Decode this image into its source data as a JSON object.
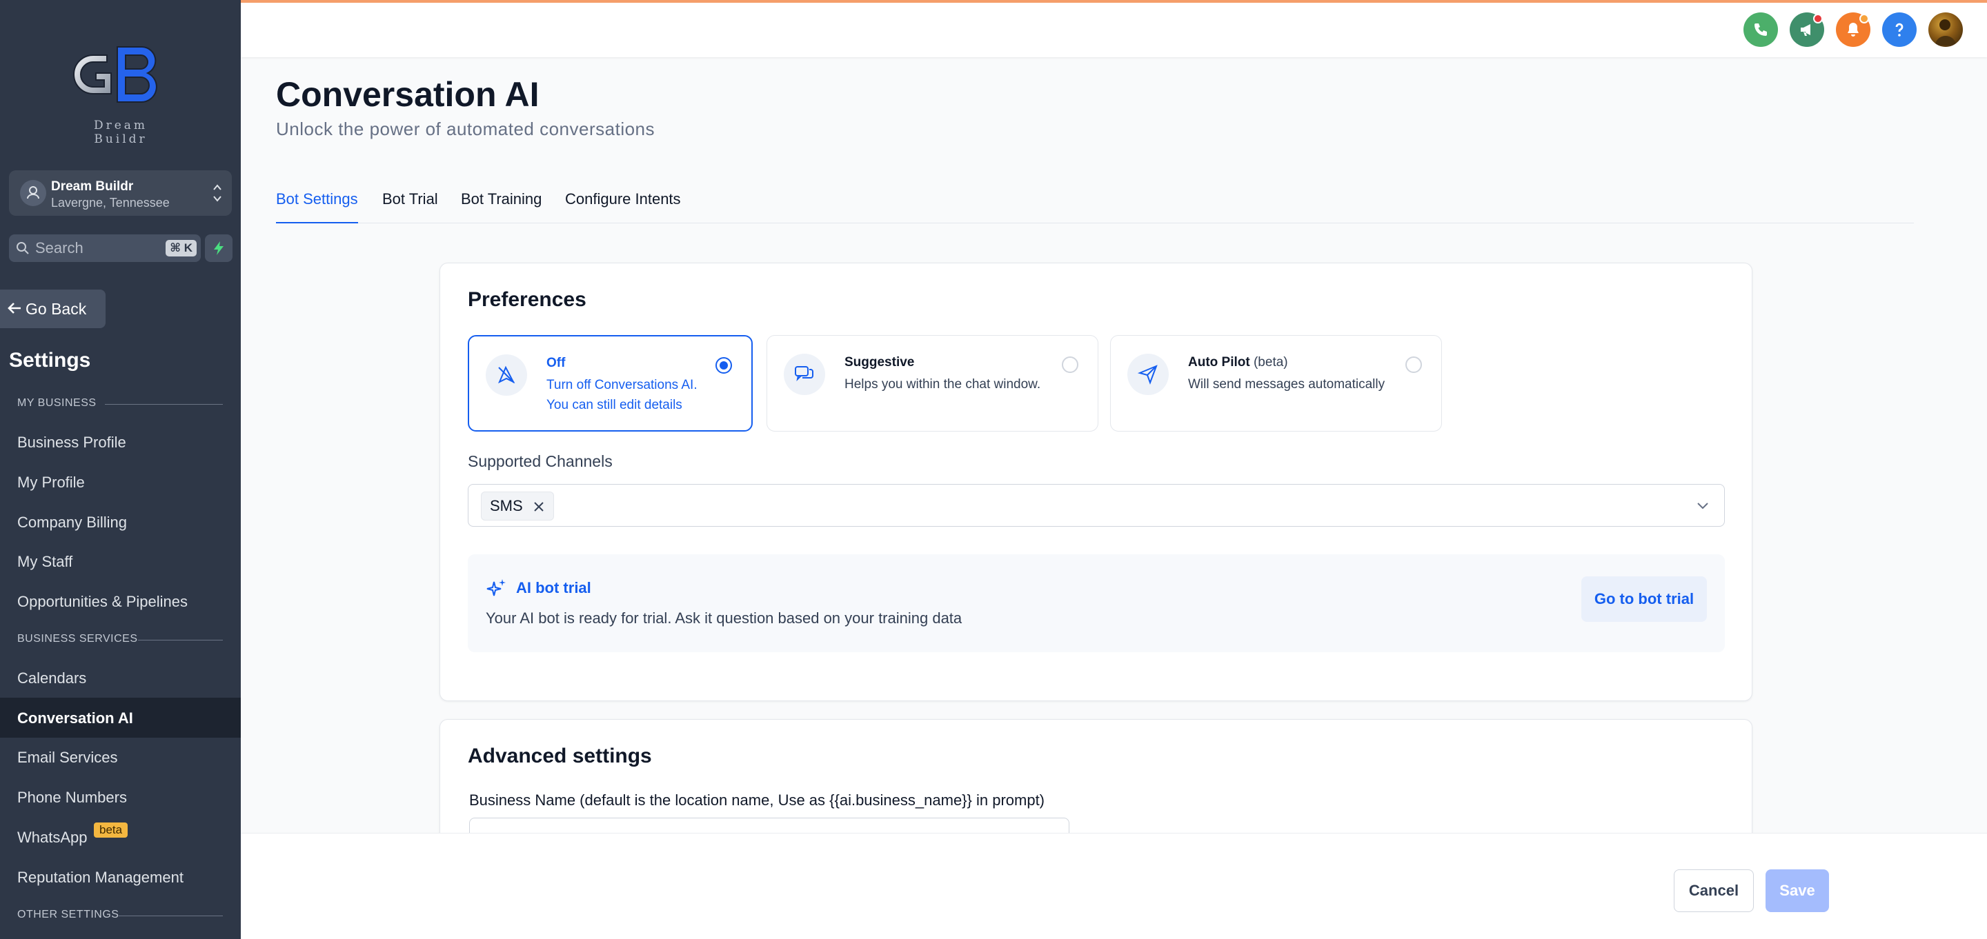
{
  "brand": {
    "logo_text": "Dream Buildr"
  },
  "location": {
    "name": "Dream Buildr",
    "city": "Lavergne, Tennessee"
  },
  "search": {
    "placeholder": "Search",
    "shortcut": "⌘ K"
  },
  "nav": {
    "go_back": "Go Back",
    "settings_title": "Settings",
    "sections": [
      "MY BUSINESS",
      "BUSINESS SERVICES",
      "OTHER SETTINGS"
    ],
    "my_business": [
      "Business Profile",
      "My Profile",
      "Company Billing",
      "My Staff",
      "Opportunities & Pipelines"
    ],
    "business_services": [
      "Calendars",
      "Conversation AI",
      "Email Services",
      "Phone Numbers",
      "WhatsApp",
      "Reputation Management"
    ],
    "active_item": "Conversation AI",
    "whatsapp_badge": "beta"
  },
  "topbar": {
    "icons": [
      "phone-icon",
      "megaphone-icon",
      "bell-icon",
      "help-icon"
    ],
    "colors": {
      "phone": "#4caf6a",
      "megaphone": "#3f8f6b",
      "bell": "#f47c2c",
      "help": "#2f80ed",
      "dot_red": "#e5383b",
      "dot_orange": "#f6a23c"
    }
  },
  "header": {
    "title": "Conversation AI",
    "subtitle": "Unlock the power of automated conversations"
  },
  "tabs": [
    "Bot Settings",
    "Bot Trial",
    "Bot Training",
    "Configure Intents"
  ],
  "active_tab": "Bot Settings",
  "preferences": {
    "title": "Preferences",
    "modes": [
      {
        "title": "Off",
        "desc_line1": "Turn off Conversations AI.",
        "desc_line2": "You can still edit details",
        "selected": true
      },
      {
        "title": "Suggestive",
        "desc_line1": "Helps you within the chat window.",
        "selected": false
      },
      {
        "title": "Auto Pilot",
        "title_suffix": "(beta)",
        "desc_line1": "Will send messages automatically",
        "selected": false
      }
    ],
    "channels_label": "Supported Channels",
    "channels": [
      "SMS"
    ],
    "trial": {
      "title": "AI bot trial",
      "desc": "Your AI bot is ready for trial. Ask it question based on your training data",
      "button": "Go to bot trial"
    }
  },
  "advanced": {
    "title": "Advanced settings",
    "business_name_label": "Business Name (default is the location name, Use as {{ai.business_name}} in prompt)"
  },
  "footer": {
    "cancel": "Cancel",
    "save": "Save"
  },
  "colors": {
    "accent": "#155eef",
    "sidebar": "#2e3747",
    "save_disabled": "#a4bcfd"
  }
}
